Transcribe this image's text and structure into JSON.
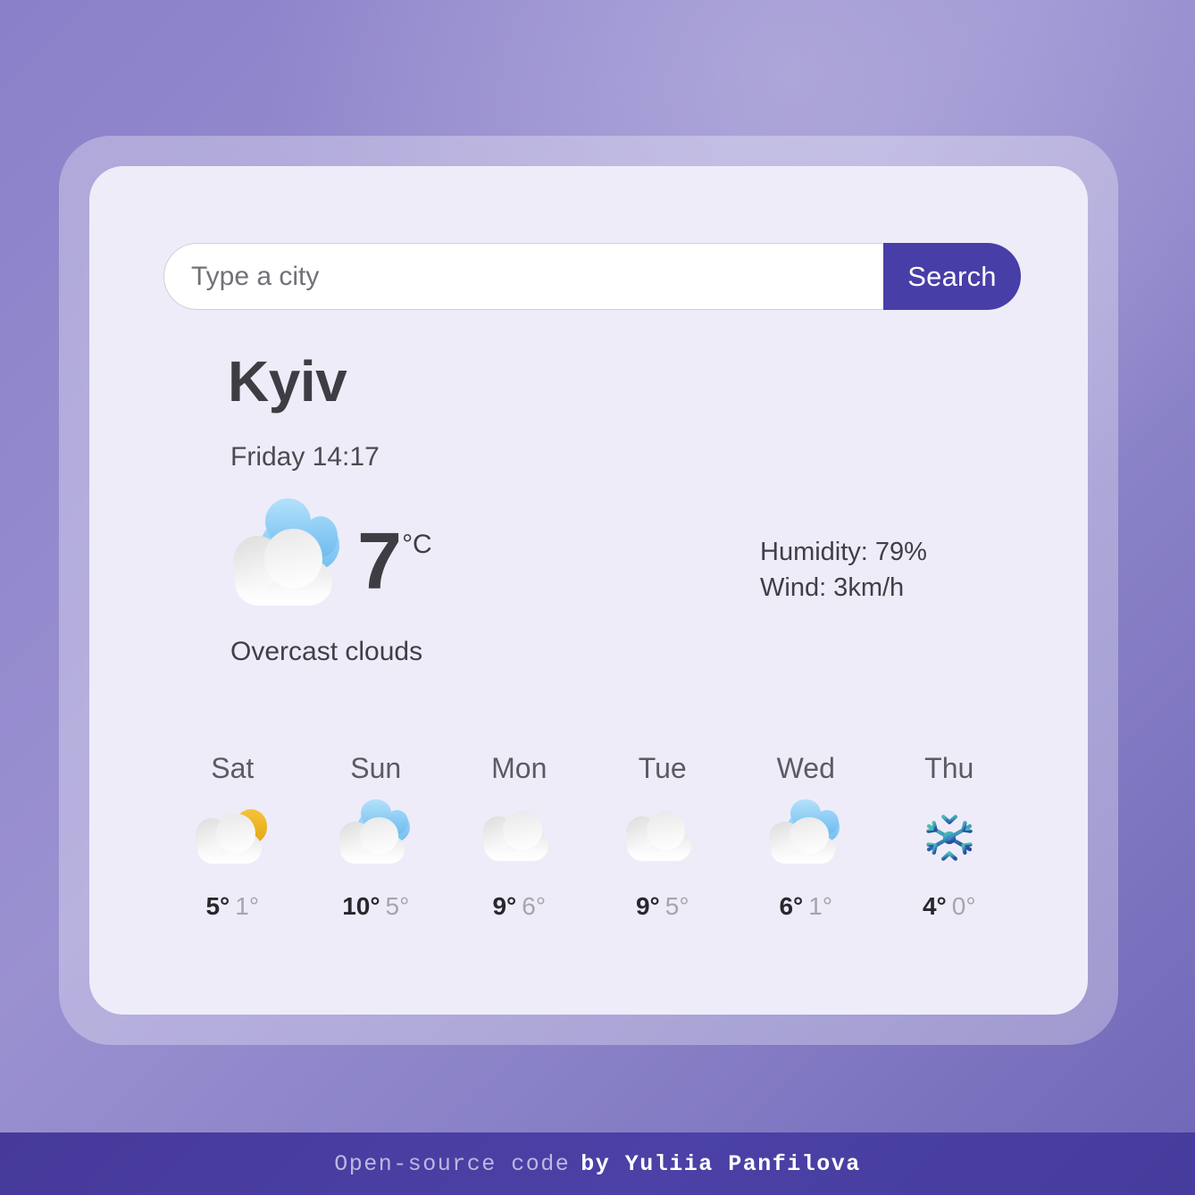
{
  "app": {
    "background_accent": "#8a80c9",
    "card_background": "#eeecf8",
    "brand_color": "#483ea8"
  },
  "search": {
    "placeholder": "Type a city",
    "value": "",
    "button_label": "Search"
  },
  "current": {
    "city": "Kyiv",
    "datetime": "Friday 14:17",
    "temperature": "7",
    "unit": "°C",
    "description": "Overcast clouds",
    "icon": "overcast-clouds-icon",
    "humidity": "Humidity: 79%",
    "wind": "Wind: 3km/h"
  },
  "forecast": [
    {
      "day": "Sat",
      "icon": "sun-behind-cloud-icon",
      "max": "5°",
      "min": "1°"
    },
    {
      "day": "Sun",
      "icon": "overcast-clouds-icon",
      "max": "10°",
      "min": "5°"
    },
    {
      "day": "Mon",
      "icon": "cloud-icon",
      "max": "9°",
      "min": "6°"
    },
    {
      "day": "Tue",
      "icon": "cloud-icon",
      "max": "9°",
      "min": "5°"
    },
    {
      "day": "Wed",
      "icon": "overcast-clouds-icon",
      "max": "6°",
      "min": "1°"
    },
    {
      "day": "Thu",
      "icon": "snowflake-icon",
      "max": "4°",
      "min": "0°"
    }
  ],
  "footer": {
    "prefix": "Open-source code",
    "author": "by Yuliia Panfilova"
  }
}
